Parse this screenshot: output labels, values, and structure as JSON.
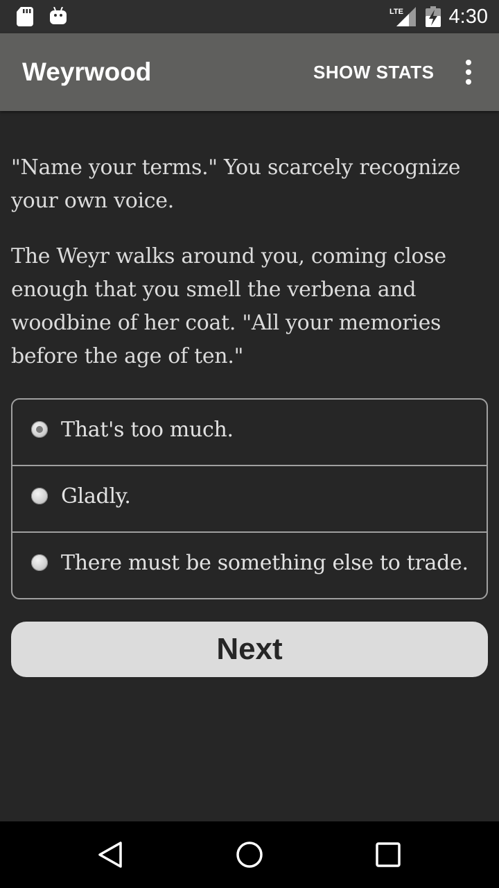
{
  "status_bar": {
    "time": "4:30",
    "network": "LTE",
    "icons": [
      "sd-card-icon",
      "android-debug-icon",
      "lte-signal-icon",
      "battery-charging-icon"
    ]
  },
  "app_bar": {
    "title": "Weyrwood",
    "show_stats_label": "SHOW STATS",
    "overflow_icon": "more-vert-icon"
  },
  "story": {
    "paragraphs": [
      "\"Name your terms.\" You scarcely recognize your own voice.",
      "The Weyr walks around you, coming close enough that you smell the verbena and woodbine of her coat. \"All your memories before the age of ten.\""
    ]
  },
  "choices": {
    "options": [
      {
        "label": "That's too much.",
        "selected": true
      },
      {
        "label": "Gladly.",
        "selected": false
      },
      {
        "label": "There must be something else to trade.",
        "selected": false
      }
    ]
  },
  "next_button": {
    "label": "Next"
  },
  "nav_bar": {
    "icons": [
      "back-icon",
      "home-icon",
      "recents-icon"
    ]
  },
  "colors": {
    "background": "#262626",
    "app_bar": "#5f5f5d",
    "button": "#dcdcdc"
  }
}
